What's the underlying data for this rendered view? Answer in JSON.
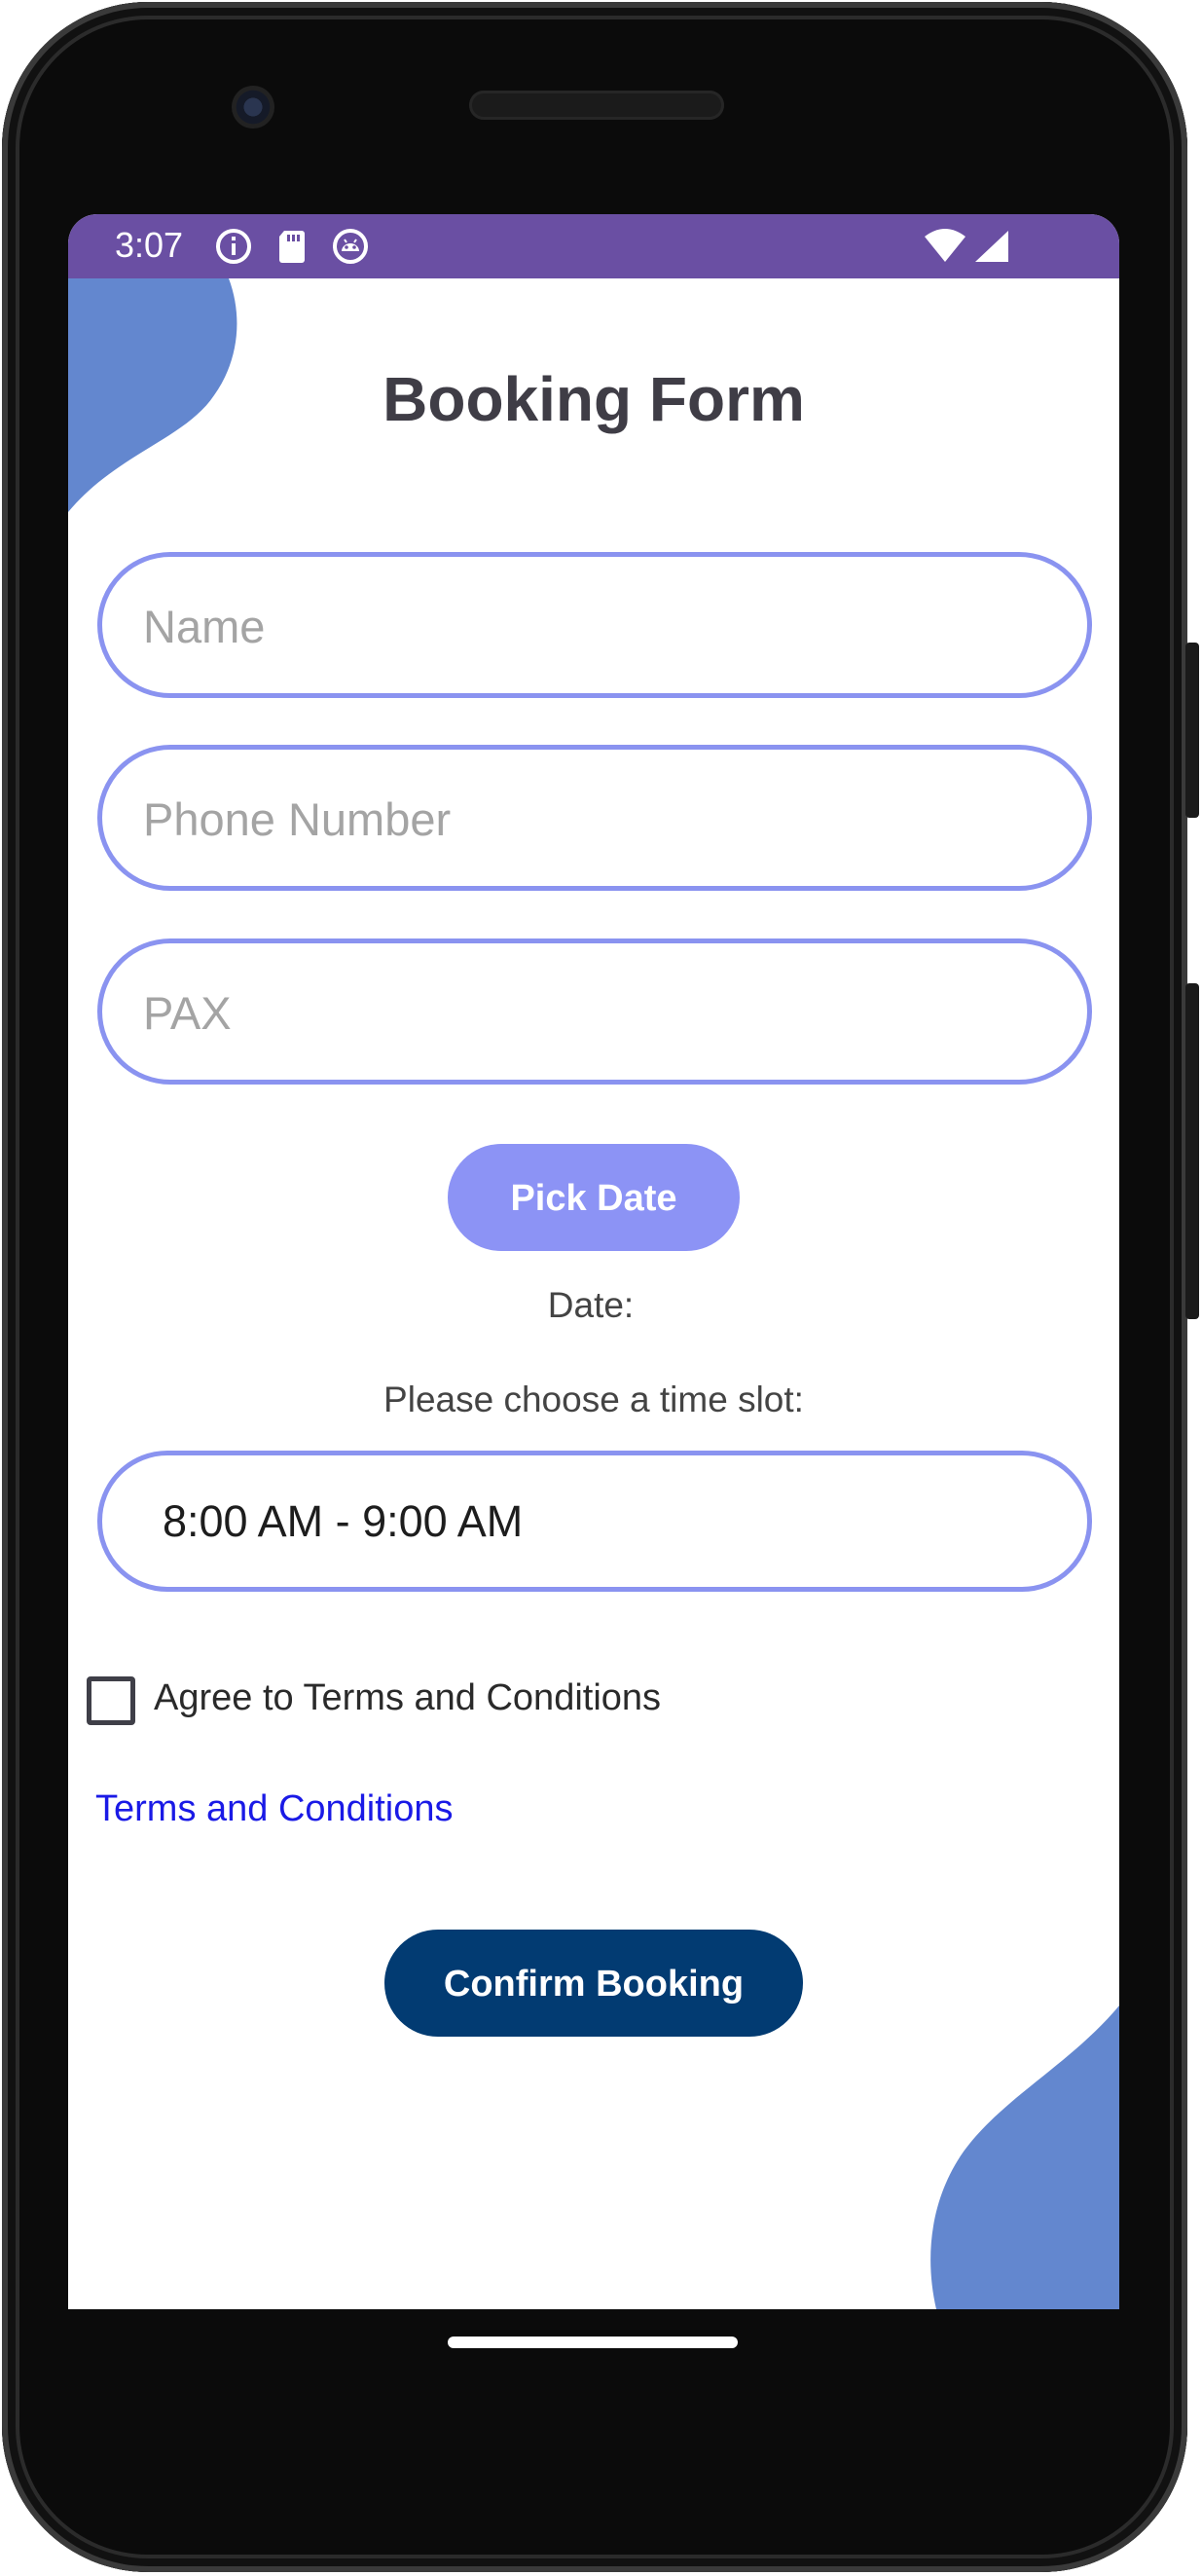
{
  "status_bar": {
    "time": "3:07",
    "icons_left": [
      "info-icon",
      "sd-card-icon",
      "android-debug-icon"
    ],
    "icons_right": [
      "wifi-icon",
      "cell-signal-icon"
    ],
    "background": "#6a4fa3"
  },
  "form": {
    "title": "Booking Form",
    "name_placeholder": "Name",
    "phone_placeholder": "Phone Number",
    "pax_placeholder": "PAX",
    "pick_date_label": "Pick Date",
    "date_label": "Date:",
    "time_slot_prompt": "Please choose a time slot:",
    "time_slot_selected": "8:00 AM - 9:00 AM",
    "agree_label": "Agree to Terms and Conditions",
    "agree_checked": false,
    "terms_link": "Terms and Conditions",
    "confirm_label": "Confirm Booking"
  },
  "colors": {
    "field_border": "#8a93f0",
    "pick_date_bg": "#8c93f5",
    "confirm_bg": "#023b72",
    "blob": "#6387cf",
    "link": "#1a1ae6"
  }
}
